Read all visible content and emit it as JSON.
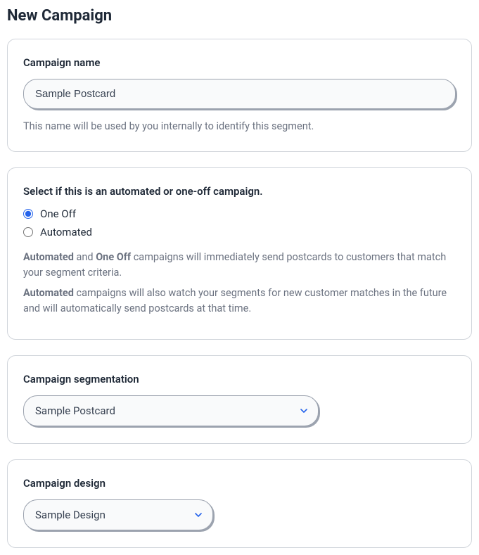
{
  "page": {
    "title": "New Campaign"
  },
  "nameCard": {
    "label": "Campaign name",
    "value": "Sample Postcard",
    "help": "This name will be used by you internally to identify this segment."
  },
  "typeCard": {
    "label": "Select if this is an automated or one-off campaign.",
    "options": {
      "oneoff": "One Off",
      "automated": "Automated"
    },
    "selected": "oneoff",
    "help1_strong1": "Automated",
    "help1_mid": " and ",
    "help1_strong2": "One Off",
    "help1_rest": " campaigns will immediately send postcards to customers that match your segment criteria.",
    "help2_strong": "Automated",
    "help2_rest": " campaigns will also watch your segments for new customer matches in the future and will automatically send postcards at that time."
  },
  "segmentationCard": {
    "label": "Campaign segmentation",
    "value": "Sample Postcard"
  },
  "designCard": {
    "label": "Campaign design",
    "value": "Sample Design"
  }
}
